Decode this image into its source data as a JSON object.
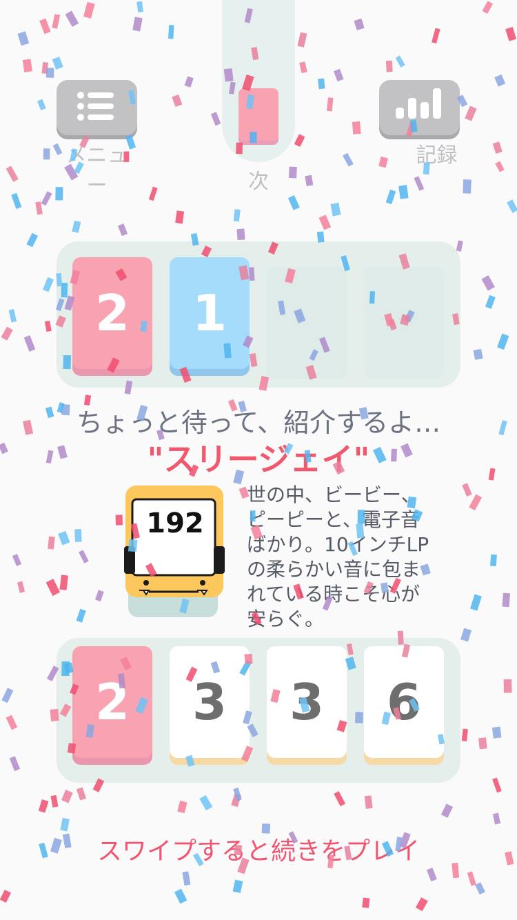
{
  "top": {
    "menu_label": "メニュー",
    "next_label": "次",
    "records_label": "記録"
  },
  "next_card": {
    "color": "#f9a3b2"
  },
  "top_board": {
    "cards": [
      {
        "value": "2",
        "color": "red"
      },
      {
        "value": "1",
        "color": "blue"
      },
      {
        "value": "",
        "color": "empty"
      },
      {
        "value": "",
        "color": "empty"
      }
    ]
  },
  "intro": {
    "heading": "ちょっと待って、紹介するよ…",
    "character_name": "\"スリージェイ\"",
    "character_value": "192",
    "description_lines": [
      "世の中、ビービー、",
      "ピーピーと、電子音",
      "ばかり。10インチLP",
      "の柔らかい音に包ま",
      "れている時こそ心が",
      "安らぐ。"
    ]
  },
  "bottom_board": {
    "cards": [
      {
        "value": "2",
        "color": "red"
      },
      {
        "value": "3",
        "color": "white"
      },
      {
        "value": "3",
        "color": "white"
      },
      {
        "value": "6",
        "color": "white"
      }
    ]
  },
  "swipe_prompt": "スワイプすると続きをプレイ",
  "colors": {
    "red": "#f9a3b2",
    "blue": "#a5dcfc",
    "accent": "#f1576d",
    "board": "#e4efec"
  }
}
